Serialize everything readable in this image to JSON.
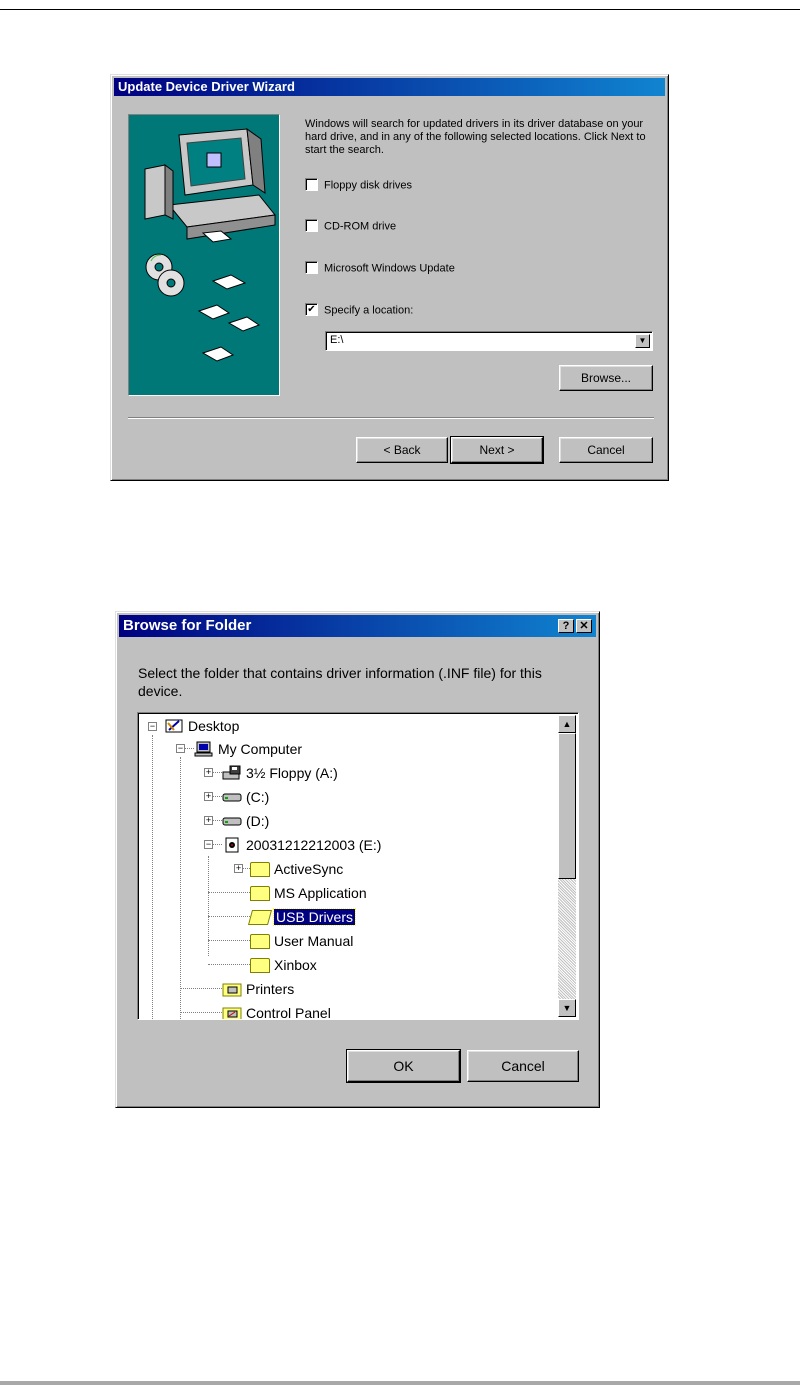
{
  "wizard": {
    "title": "Update Device Driver Wizard",
    "intro": "Windows will search for updated drivers in its driver database on your hard drive, and in any of the following selected locations. Click Next to start the search.",
    "options": [
      {
        "label": "Floppy disk drives",
        "checked": false
      },
      {
        "label": "CD-ROM drive",
        "checked": false
      },
      {
        "label": "Microsoft Windows Update",
        "checked": false
      },
      {
        "label": "Specify a location:",
        "checked": true
      }
    ],
    "location_value": "E:\\",
    "browse_label": "Browse...",
    "back_label": "< Back",
    "next_label": "Next >",
    "cancel_label": "Cancel"
  },
  "browse": {
    "title": "Browse for Folder",
    "help_label": "?",
    "close_label": "✕",
    "message": "Select the folder that contains driver information (.INF file) for this device.",
    "tree": [
      {
        "label": "Desktop",
        "icon": "desktop-icon"
      },
      {
        "label": "My Computer",
        "icon": "computer-icon"
      },
      {
        "label": "3½ Floppy (A:)",
        "icon": "floppy-icon"
      },
      {
        "label": "(C:)",
        "icon": "drive-icon"
      },
      {
        "label": "(D:)",
        "icon": "drive-icon"
      },
      {
        "label": "20031212212003 (E:)",
        "icon": "cd-drive-icon"
      },
      {
        "label": "ActiveSync",
        "icon": "folder-icon"
      },
      {
        "label": "MS Application",
        "icon": "folder-icon"
      },
      {
        "label": "USB Drivers",
        "icon": "open-folder-icon",
        "selected": true
      },
      {
        "label": "User Manual",
        "icon": "folder-icon"
      },
      {
        "label": "Xinbox",
        "icon": "folder-icon"
      },
      {
        "label": "Printers",
        "icon": "printer-folder-icon"
      },
      {
        "label": "Control Panel",
        "icon": "control-panel-icon"
      }
    ],
    "ok_label": "OK",
    "cancel_label": "Cancel"
  }
}
